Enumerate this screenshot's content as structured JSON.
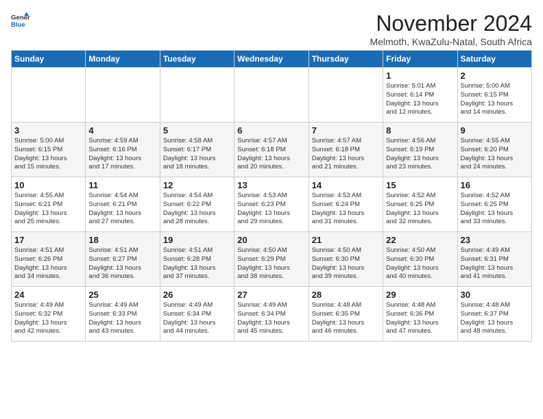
{
  "header": {
    "logo_general": "General",
    "logo_blue": "Blue",
    "title": "November 2024",
    "location": "Melmoth, KwaZulu-Natal, South Africa"
  },
  "days_of_week": [
    "Sunday",
    "Monday",
    "Tuesday",
    "Wednesday",
    "Thursday",
    "Friday",
    "Saturday"
  ],
  "weeks": [
    [
      {
        "day": "",
        "info": ""
      },
      {
        "day": "",
        "info": ""
      },
      {
        "day": "",
        "info": ""
      },
      {
        "day": "",
        "info": ""
      },
      {
        "day": "",
        "info": ""
      },
      {
        "day": "1",
        "info": "Sunrise: 5:01 AM\nSunset: 6:14 PM\nDaylight: 13 hours\nand 12 minutes."
      },
      {
        "day": "2",
        "info": "Sunrise: 5:00 AM\nSunset: 6:15 PM\nDaylight: 13 hours\nand 14 minutes."
      }
    ],
    [
      {
        "day": "3",
        "info": "Sunrise: 5:00 AM\nSunset: 6:15 PM\nDaylight: 13 hours\nand 15 minutes."
      },
      {
        "day": "4",
        "info": "Sunrise: 4:59 AM\nSunset: 6:16 PM\nDaylight: 13 hours\nand 17 minutes."
      },
      {
        "day": "5",
        "info": "Sunrise: 4:58 AM\nSunset: 6:17 PM\nDaylight: 13 hours\nand 18 minutes."
      },
      {
        "day": "6",
        "info": "Sunrise: 4:57 AM\nSunset: 6:18 PM\nDaylight: 13 hours\nand 20 minutes."
      },
      {
        "day": "7",
        "info": "Sunrise: 4:57 AM\nSunset: 6:18 PM\nDaylight: 13 hours\nand 21 minutes."
      },
      {
        "day": "8",
        "info": "Sunrise: 4:56 AM\nSunset: 6:19 PM\nDaylight: 13 hours\nand 23 minutes."
      },
      {
        "day": "9",
        "info": "Sunrise: 4:55 AM\nSunset: 6:20 PM\nDaylight: 13 hours\nand 24 minutes."
      }
    ],
    [
      {
        "day": "10",
        "info": "Sunrise: 4:55 AM\nSunset: 6:21 PM\nDaylight: 13 hours\nand 25 minutes."
      },
      {
        "day": "11",
        "info": "Sunrise: 4:54 AM\nSunset: 6:21 PM\nDaylight: 13 hours\nand 27 minutes."
      },
      {
        "day": "12",
        "info": "Sunrise: 4:54 AM\nSunset: 6:22 PM\nDaylight: 13 hours\nand 28 minutes."
      },
      {
        "day": "13",
        "info": "Sunrise: 4:53 AM\nSunset: 6:23 PM\nDaylight: 13 hours\nand 29 minutes."
      },
      {
        "day": "14",
        "info": "Sunrise: 4:53 AM\nSunset: 6:24 PM\nDaylight: 13 hours\nand 31 minutes."
      },
      {
        "day": "15",
        "info": "Sunrise: 4:52 AM\nSunset: 6:25 PM\nDaylight: 13 hours\nand 32 minutes."
      },
      {
        "day": "16",
        "info": "Sunrise: 4:52 AM\nSunset: 6:25 PM\nDaylight: 13 hours\nand 33 minutes."
      }
    ],
    [
      {
        "day": "17",
        "info": "Sunrise: 4:51 AM\nSunset: 6:26 PM\nDaylight: 13 hours\nand 34 minutes."
      },
      {
        "day": "18",
        "info": "Sunrise: 4:51 AM\nSunset: 6:27 PM\nDaylight: 13 hours\nand 36 minutes."
      },
      {
        "day": "19",
        "info": "Sunrise: 4:51 AM\nSunset: 6:28 PM\nDaylight: 13 hours\nand 37 minutes."
      },
      {
        "day": "20",
        "info": "Sunrise: 4:50 AM\nSunset: 6:29 PM\nDaylight: 13 hours\nand 38 minutes."
      },
      {
        "day": "21",
        "info": "Sunrise: 4:50 AM\nSunset: 6:30 PM\nDaylight: 13 hours\nand 39 minutes."
      },
      {
        "day": "22",
        "info": "Sunrise: 4:50 AM\nSunset: 6:30 PM\nDaylight: 13 hours\nand 40 minutes."
      },
      {
        "day": "23",
        "info": "Sunrise: 4:49 AM\nSunset: 6:31 PM\nDaylight: 13 hours\nand 41 minutes."
      }
    ],
    [
      {
        "day": "24",
        "info": "Sunrise: 4:49 AM\nSunset: 6:32 PM\nDaylight: 13 hours\nand 42 minutes."
      },
      {
        "day": "25",
        "info": "Sunrise: 4:49 AM\nSunset: 6:33 PM\nDaylight: 13 hours\nand 43 minutes."
      },
      {
        "day": "26",
        "info": "Sunrise: 4:49 AM\nSunset: 6:34 PM\nDaylight: 13 hours\nand 44 minutes."
      },
      {
        "day": "27",
        "info": "Sunrise: 4:49 AM\nSunset: 6:34 PM\nDaylight: 13 hours\nand 45 minutes."
      },
      {
        "day": "28",
        "info": "Sunrise: 4:48 AM\nSunset: 6:35 PM\nDaylight: 13 hours\nand 46 minutes."
      },
      {
        "day": "29",
        "info": "Sunrise: 4:48 AM\nSunset: 6:36 PM\nDaylight: 13 hours\nand 47 minutes."
      },
      {
        "day": "30",
        "info": "Sunrise: 4:48 AM\nSunset: 6:37 PM\nDaylight: 13 hours\nand 48 minutes."
      }
    ]
  ]
}
